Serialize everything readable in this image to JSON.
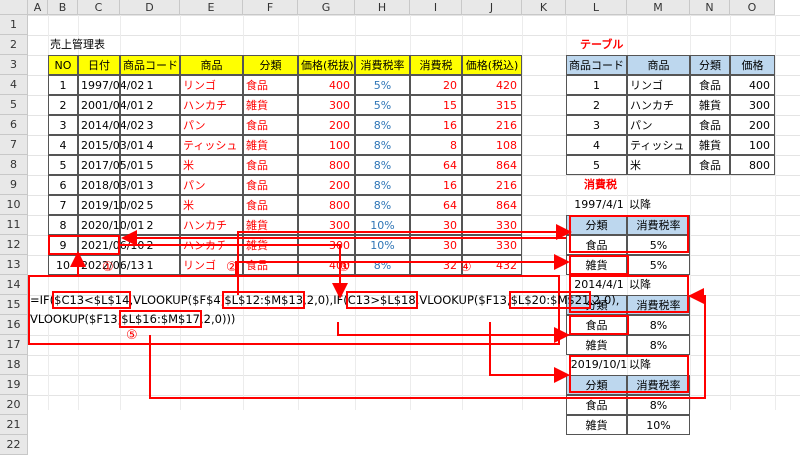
{
  "col_headers": [
    "A",
    "B",
    "C",
    "D",
    "E",
    "F",
    "G",
    "H",
    "I",
    "J",
    "K",
    "L",
    "M",
    "N",
    "O"
  ],
  "row_numbers": [
    "1",
    "2",
    "3",
    "4",
    "5",
    "6",
    "7",
    "8",
    "9",
    "10",
    "11",
    "12",
    "13",
    "14",
    "15",
    "16",
    "17",
    "18",
    "19",
    "20",
    "21",
    "22"
  ],
  "sales": {
    "title": "売上管理表",
    "headers": [
      "NO",
      "日付",
      "商品コード",
      "商品",
      "分類",
      "価格(税抜)",
      "消費税率",
      "消費税",
      "価格(税込)"
    ],
    "rows": [
      [
        "1",
        "1997/04/02",
        "1",
        "リンゴ",
        "食品",
        "400",
        "5%",
        "20",
        "420"
      ],
      [
        "2",
        "2001/04/01",
        "2",
        "ハンカチ",
        "雑貨",
        "300",
        "5%",
        "15",
        "315"
      ],
      [
        "3",
        "2014/04/02",
        "3",
        "パン",
        "食品",
        "200",
        "8%",
        "16",
        "216"
      ],
      [
        "4",
        "2015/03/01",
        "4",
        "ティッシュ",
        "雑貨",
        "100",
        "8%",
        "8",
        "108"
      ],
      [
        "5",
        "2017/05/01",
        "5",
        "米",
        "食品",
        "800",
        "8%",
        "64",
        "864"
      ],
      [
        "6",
        "2018/03/01",
        "3",
        "パン",
        "食品",
        "200",
        "8%",
        "16",
        "216"
      ],
      [
        "7",
        "2019/10/02",
        "5",
        "米",
        "食品",
        "800",
        "8%",
        "64",
        "864"
      ],
      [
        "8",
        "2020/10/01",
        "2",
        "ハンカチ",
        "雑貨",
        "300",
        "10%",
        "30",
        "330"
      ],
      [
        "9",
        "2021/06/10",
        "2",
        "ハンカチ",
        "雑貨",
        "300",
        "10%",
        "30",
        "330"
      ],
      [
        "10",
        "2022/06/13",
        "1",
        "リンゴ",
        "食品",
        "400",
        "8%",
        "32",
        "432"
      ]
    ]
  },
  "table": {
    "title": "テーブル",
    "headers": [
      "商品コード",
      "商品",
      "分類",
      "価格"
    ],
    "rows": [
      [
        "1",
        "リンゴ",
        "食品",
        "400"
      ],
      [
        "2",
        "ハンカチ",
        "雑貨",
        "300"
      ],
      [
        "3",
        "パン",
        "食品",
        "200"
      ],
      [
        "4",
        "ティッシュ",
        "雑貨",
        "100"
      ],
      [
        "5",
        "米",
        "食品",
        "800"
      ]
    ]
  },
  "tax": {
    "title": "消費税",
    "suffix": "以降",
    "headers": [
      "分類",
      "消費税率"
    ],
    "periods": [
      {
        "date": "1997/4/1",
        "rows": [
          [
            "食品",
            "5%"
          ],
          [
            "雑貨",
            "5%"
          ]
        ]
      },
      {
        "date": "2014/4/1",
        "rows": [
          [
            "食品",
            "8%"
          ],
          [
            "雑貨",
            "8%"
          ]
        ]
      },
      {
        "date": "2019/10/1",
        "rows": [
          [
            "食品",
            "8%"
          ],
          [
            "雑貨",
            "10%"
          ]
        ]
      }
    ]
  },
  "formula": {
    "line1": [
      {
        "t": "=IF(",
        "box": false
      },
      {
        "t": "$C13<$L$14",
        "box": true
      },
      {
        "t": ",VLOOKUP($F$4,",
        "box": false
      },
      {
        "t": "$L$12:$M$13",
        "box": true
      },
      {
        "t": ",2,0),IF(",
        "box": false
      },
      {
        "t": "C13>$L$18",
        "box": true
      },
      {
        "t": ",VLOOKUP($F13,",
        "box": false
      },
      {
        "t": "$L$20:$M$21",
        "box": true
      },
      {
        "t": ",2,0),",
        "box": false
      }
    ],
    "line2": [
      {
        "t": "VLOOKUP($F13,",
        "box": false
      },
      {
        "t": "$L$16:$M$17",
        "box": true
      },
      {
        "t": ",2,0)))",
        "box": false
      }
    ],
    "markers": [
      "①",
      "②",
      "③",
      "④",
      "⑤"
    ]
  }
}
